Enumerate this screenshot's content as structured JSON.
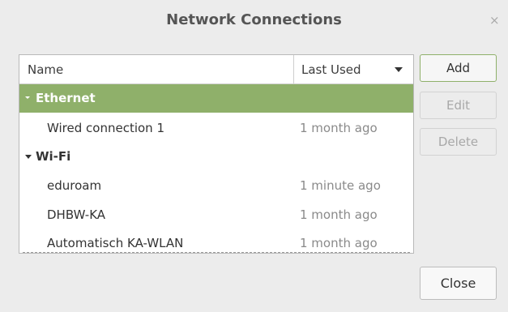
{
  "window": {
    "title": "Network Connections",
    "close_symbol": "×"
  },
  "table": {
    "headers": {
      "name": "Name",
      "last_used": "Last Used"
    },
    "groups": [
      {
        "label": "Ethernet",
        "selected": true,
        "items": [
          {
            "name": "Wired connection 1",
            "last_used": "1 month ago"
          }
        ]
      },
      {
        "label": "Wi-Fi",
        "selected": false,
        "items": [
          {
            "name": "eduroam",
            "last_used": "1 minute ago"
          },
          {
            "name": "DHBW-KA",
            "last_used": "1 month ago"
          },
          {
            "name": "Automatisch KA-WLAN",
            "last_used": "1 month ago"
          }
        ]
      }
    ]
  },
  "buttons": {
    "add": "Add",
    "edit": "Edit",
    "delete": "Delete",
    "close": "Close"
  },
  "colors": {
    "selection": "#8fb06a",
    "background": "#ececec"
  },
  "icons": {
    "expander": "triangle-down-icon",
    "sort": "sort-down-icon"
  }
}
